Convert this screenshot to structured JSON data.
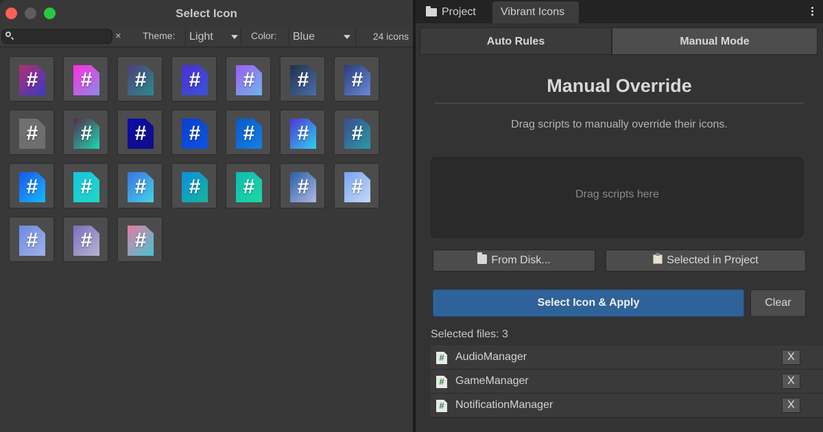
{
  "select_icon_window": {
    "title": "Select Icon",
    "search": {
      "value": "",
      "placeholder": ""
    },
    "clear_symbol": "×",
    "theme": {
      "label": "Theme:",
      "value": "Light"
    },
    "color": {
      "label": "Color:",
      "value": "Blue"
    },
    "icon_count": "24 icons",
    "icon_glyph": "#",
    "icons": [
      {
        "name": "icon-1",
        "colors": [
          "#b0306f",
          "#3c38c8"
        ]
      },
      {
        "name": "icon-2",
        "colors": [
          "#ff2de0",
          "#8a8ce8"
        ]
      },
      {
        "name": "icon-3",
        "colors": [
          "#4f3e7a",
          "#2a8c8f"
        ]
      },
      {
        "name": "icon-4",
        "colors": [
          "#4b2fd6",
          "#3a54d8"
        ]
      },
      {
        "name": "icon-5",
        "colors": [
          "#9c5cf0",
          "#6fb6ee"
        ]
      },
      {
        "name": "icon-6",
        "colors": [
          "#203249",
          "#4a6eaa"
        ]
      },
      {
        "name": "icon-7",
        "colors": [
          "#2b3c7d",
          "#6a8ad6"
        ]
      },
      {
        "name": "icon-8",
        "colors": [
          "#707070",
          "#6e6e6e"
        ]
      },
      {
        "name": "icon-9",
        "colors": [
          "#552c4e",
          "#1ad9b0"
        ]
      },
      {
        "name": "icon-10",
        "colors": [
          "#0e0ca8",
          "#100d85"
        ]
      },
      {
        "name": "icon-11",
        "colors": [
          "#0a3fd0",
          "#0d54de"
        ]
      },
      {
        "name": "icon-12",
        "colors": [
          "#0a59c8",
          "#1580e6"
        ]
      },
      {
        "name": "icon-13",
        "colors": [
          "#5036d9",
          "#2fd0f0"
        ]
      },
      {
        "name": "icon-14",
        "colors": [
          "#3a4c91",
          "#2a9aa4"
        ]
      },
      {
        "name": "icon-15",
        "colors": [
          "#1a56e8",
          "#18b9ff"
        ]
      },
      {
        "name": "icon-16",
        "colors": [
          "#19c4e0",
          "#1fd8c4"
        ]
      },
      {
        "name": "icon-17",
        "colors": [
          "#3b73e0",
          "#45d4e8"
        ]
      },
      {
        "name": "icon-18",
        "colors": [
          "#0d8ee0",
          "#14b59a"
        ]
      },
      {
        "name": "icon-19",
        "colors": [
          "#0dbcb0",
          "#1ed8a4"
        ]
      },
      {
        "name": "icon-20",
        "colors": [
          "#2a5fa8",
          "#b0b8e0"
        ]
      },
      {
        "name": "icon-21",
        "colors": [
          "#7ba3f0",
          "#c6d9f6"
        ]
      },
      {
        "name": "icon-22",
        "colors": [
          "#6d8ae0",
          "#9fb2e8"
        ]
      },
      {
        "name": "icon-23",
        "colors": [
          "#7a6fbf",
          "#b6b5d0"
        ]
      },
      {
        "name": "icon-24",
        "colors": [
          "#e67aa4",
          "#44c6d0"
        ]
      }
    ]
  },
  "vibrant_window": {
    "tabs": {
      "project": "Project",
      "vibrant": "Vibrant Icons"
    },
    "modes": {
      "auto": "Auto Rules",
      "manual": "Manual Mode"
    },
    "title": "Manual Override",
    "description": "Drag scripts to manually override their icons.",
    "dropzone_text": "Drag scripts here",
    "buttons": {
      "from_disk": "From Disk...",
      "selected_in_project": "Selected in Project",
      "apply": "Select Icon & Apply",
      "clear": "Clear",
      "remove": "X"
    },
    "selected_label": "Selected files: 3",
    "files": [
      "AudioManager",
      "GameManager",
      "NotificationManager"
    ]
  }
}
